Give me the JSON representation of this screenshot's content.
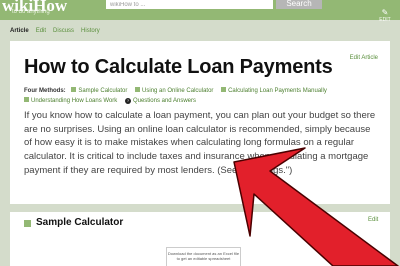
{
  "header": {
    "logo": "wikiHow",
    "tagline": "to do anything",
    "search_placeholder": "wikiHow to ...",
    "search_button": "Search",
    "edit_label": "EDIT"
  },
  "tabs": [
    "Article",
    "Edit",
    "Discuss",
    "History"
  ],
  "article": {
    "title": "How to Calculate Loan Payments",
    "edit_link": "Edit Article",
    "methods_label": "Four Methods:",
    "methods": [
      "Sample Calculator",
      "Using an Online Calculator",
      "Calculating Loan Payments Manually",
      "Understanding How Loans Work",
      "Questions and Answers"
    ],
    "intro": "If you know how to calculate a loan payment, you can plan out your budget so there are no surprises. Using an online loan calculator is recommended, simply because of how easy it is to make mistakes when calculating long formulas on a regular calculator. It is critical to include taxes and insurance when calculating a mortgage payment if they are required by most lenders. (See \"Warnings.\")"
  },
  "section2": {
    "title": "Sample Calculator",
    "edit_link": "Edit",
    "thumbnail_text": "Download the document as an Excel file to get an editable spreadsheet"
  },
  "colors": {
    "brand_green": "#93b874",
    "link_green": "#4c7f2f",
    "page_bg": "#d4dccb",
    "arrow_red": "#e2202b"
  },
  "icons": [
    "pencil-icon",
    "question-icon",
    "arrow-icon"
  ]
}
